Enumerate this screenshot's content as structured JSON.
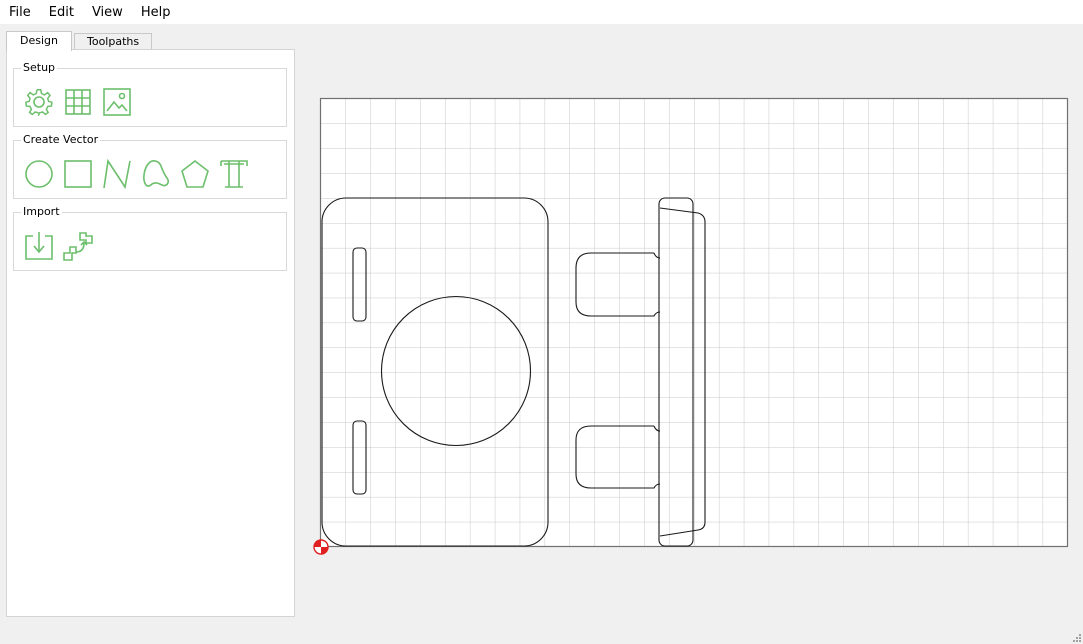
{
  "menu": {
    "file": "File",
    "edit": "Edit",
    "view": "View",
    "help": "Help"
  },
  "tabs": {
    "design": "Design",
    "toolpaths": "Toolpaths"
  },
  "groups": {
    "setup": {
      "title": "Setup",
      "tools": [
        "settings-icon",
        "grid-icon",
        "image-icon"
      ]
    },
    "create_vector": {
      "title": "Create Vector",
      "tools": [
        "circle-icon",
        "rectangle-icon",
        "polyline-icon",
        "curve-icon",
        "polygon-icon",
        "text-icon"
      ]
    },
    "import": {
      "title": "Import",
      "tools": [
        "import-file-icon",
        "import-vector-icon"
      ]
    }
  },
  "colors": {
    "tool_icon": "#6cbf6c",
    "grid_line": "#c8c8c8",
    "origin_marker": "#e02020"
  }
}
